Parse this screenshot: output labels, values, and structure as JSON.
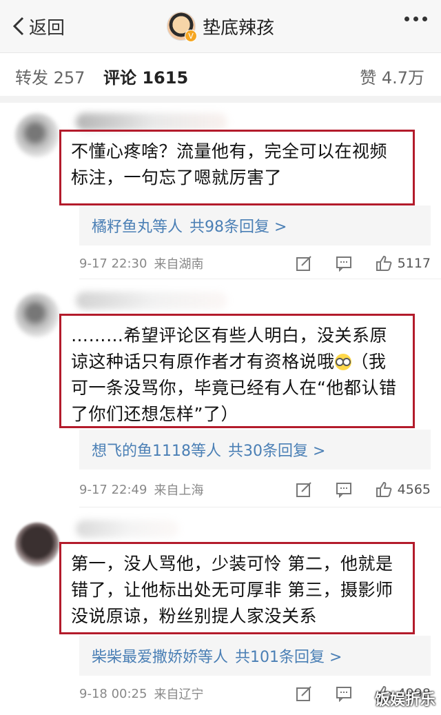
{
  "navbar": {
    "back_label": "返回",
    "title": "垫底辣孩",
    "verified_badge": "V",
    "icons": {
      "back": "chevron-left-icon",
      "more": "more-dots-icon"
    }
  },
  "tabs": [
    {
      "label": "转发 257"
    },
    {
      "label": "评论 1615"
    },
    {
      "label": "赞 4.7万"
    }
  ],
  "accent_color": "#ff8200",
  "highlight_color": "#b31b2b",
  "comments": [
    {
      "text": "不懂心疼啥？流量他有，完全可以在视频标注，一句忘了嗯就厉害了",
      "reply_name": "橘籽鱼丸等人",
      "reply_count": "共98条回复 >",
      "time": "9-17 22:30",
      "location": "来自湖南",
      "likes": "5117"
    },
    {
      "name": "我爱闲……杜门关关玩",
      "text_before": "………希望评论区有些人明白，没关系原谅这种话只有原作者才有资格说哦",
      "text_after": "（我可一条没骂你，毕竟已经有人在“他都认错了你们还想怎样”了）",
      "reply_name": "想飞的鱼1118等人",
      "reply_count": "共30条回复 >",
      "time": "9-17 22:49",
      "location": "来自上海",
      "likes": "4565"
    },
    {
      "text": "第一，没人骂他，少装可怜 第二，他就是错了，让他标出处无可厚非 第三，摄影师没说原谅，粉丝别提人家没关系",
      "reply_name": "柴柴最爱撒娇娇等人",
      "reply_count": "共101条回复 >",
      "time": "9-18 00:25",
      "location": "来自辽宁",
      "likes": "4998"
    }
  ],
  "watermark": "饭娱折乐"
}
